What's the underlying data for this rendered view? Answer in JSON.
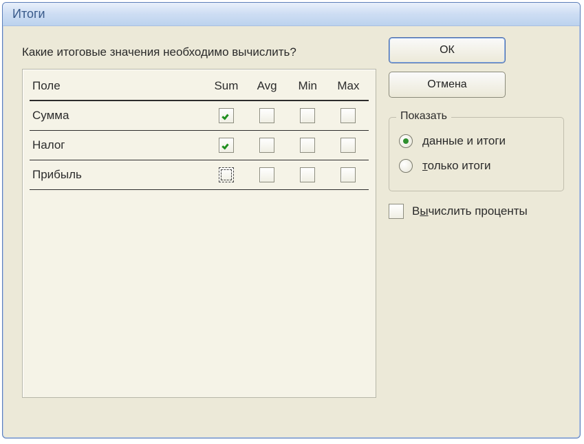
{
  "window": {
    "title": "Итоги"
  },
  "question": "Какие итоговые значения необходимо вычислить?",
  "table": {
    "header_field": "Поле",
    "header_sum": "Sum",
    "header_avg": "Avg",
    "header_min": "Min",
    "header_max": "Max",
    "rows": [
      {
        "field": "Сумма",
        "sum": true,
        "avg": false,
        "min": false,
        "max": false,
        "focused": false
      },
      {
        "field": "Налог",
        "sum": true,
        "avg": false,
        "min": false,
        "max": false,
        "focused": false
      },
      {
        "field": "Прибыль",
        "sum": false,
        "avg": false,
        "min": false,
        "max": false,
        "focused": true
      }
    ]
  },
  "buttons": {
    "ok": "ОК",
    "cancel": "Отмена"
  },
  "show_group": {
    "legend": "Показать",
    "options": [
      {
        "label_pre": "",
        "underlined": "д",
        "label_post": "анные и итоги",
        "selected": true
      },
      {
        "label_pre": "",
        "underlined": "т",
        "label_post": "олько итоги",
        "selected": false
      }
    ]
  },
  "percent_check": {
    "checked": false,
    "pre": "В",
    "underlined": "ы",
    "post": "числить проценты"
  }
}
